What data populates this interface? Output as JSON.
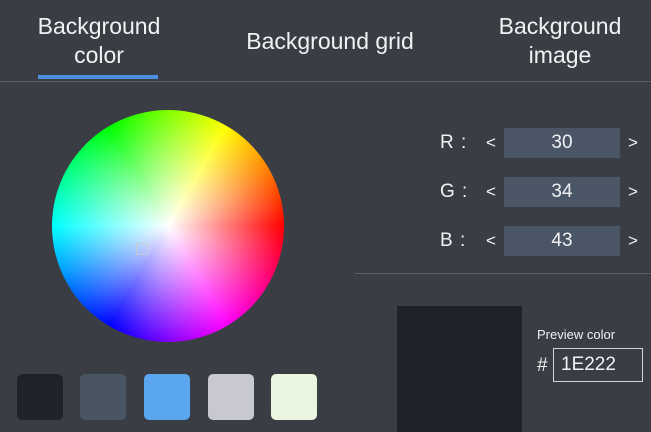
{
  "tabs": [
    {
      "label": "Background\ncolor",
      "active": true
    },
    {
      "label": "Background grid",
      "active": false
    },
    {
      "label": "Background\nimage",
      "active": false
    }
  ],
  "accent_color": "#4a90e2",
  "color_wheel": {
    "cursor_icon": "square-cursor-icon"
  },
  "rgb": {
    "r": {
      "label": "R :",
      "value": "30"
    },
    "g": {
      "label": "G :",
      "value": "34"
    },
    "b": {
      "label": "B :",
      "value": "43"
    },
    "decrement_symbol": "<",
    "increment_symbol": ">"
  },
  "preview": {
    "label": "Preview color",
    "hash_symbol": "#",
    "hex_value": "1E222",
    "color": "#1e222b"
  },
  "swatches": [
    {
      "color": "#1e222b"
    },
    {
      "color": "#4a5563"
    },
    {
      "color": "#5aa7ef"
    },
    {
      "color": "#c7c8d2"
    },
    {
      "color": "#eaf6e0"
    }
  ]
}
